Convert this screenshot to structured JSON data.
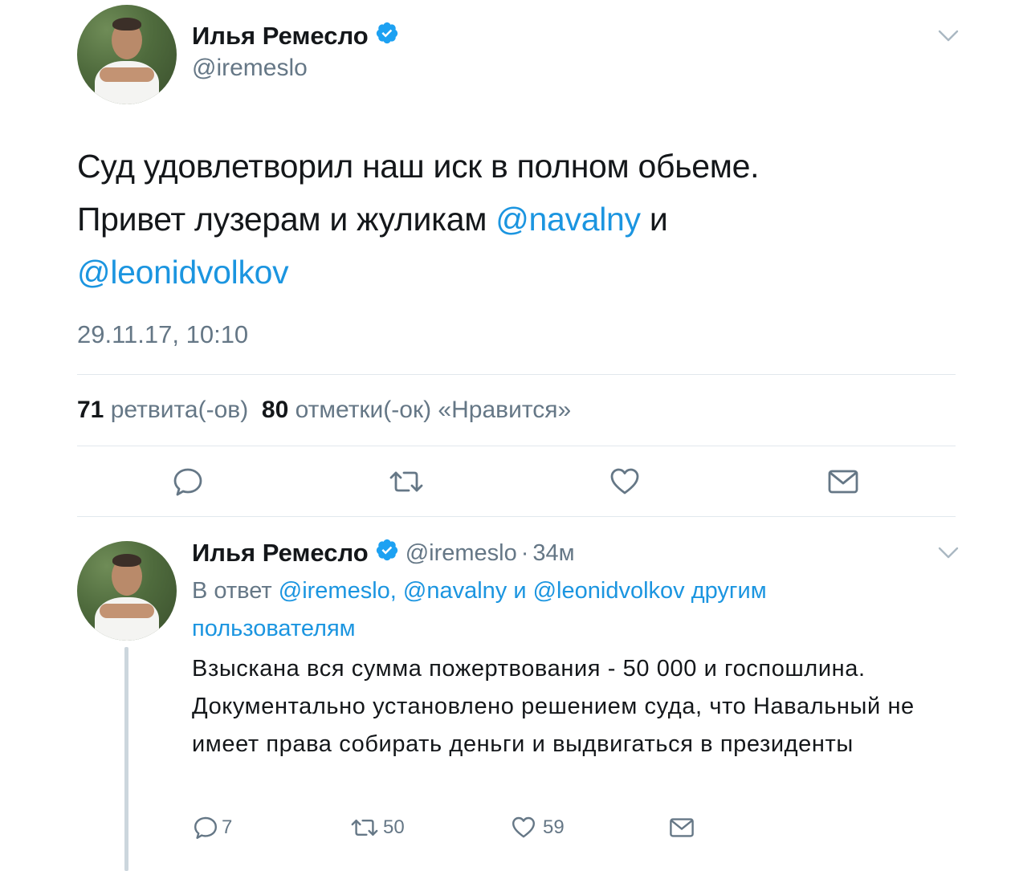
{
  "main_tweet": {
    "author_name": "Илья Ремесло",
    "handle": "@iremeslo",
    "text_part1": "Суд удовлетворил наш иск  в полном обьеме.",
    "text_part2": "Привет лузерам и жуликам ",
    "mention1": "@navalny",
    "text_part3": " и",
    "mention2": "@leonidvolkov",
    "timestamp": "29.11.17, 10:10",
    "retweets_count": "71",
    "retweets_label": "ретвита(-ов)",
    "likes_count": "80",
    "likes_label": "отметки(-ок) «Нравится»"
  },
  "reply_tweet": {
    "author_name": "Илья Ремесло",
    "handle": "@iremeslo",
    "separator": "·",
    "time": "34м",
    "reply_prefix": "В ответ ",
    "reply_mentions": "@iremeslo, @navalny и @leonidvolkov другим пользователям",
    "text": "Взыскана вся сумма пожертвования - 50 000 и госпошлина. Документально установлено решением суда, что Навальный не имеет права собирать деньги и выдвигаться в президенты",
    "replies_count": "7",
    "retweets_count": "50",
    "likes_count": "59"
  },
  "colors": {
    "link": "#1b95e0",
    "secondary_text": "#657786",
    "divider": "#e1e8ed",
    "verified": "#1da1f2"
  },
  "icons": [
    "verified-badge-icon",
    "chevron-down-icon",
    "reply-icon",
    "retweet-icon",
    "like-icon",
    "direct-message-icon"
  ]
}
